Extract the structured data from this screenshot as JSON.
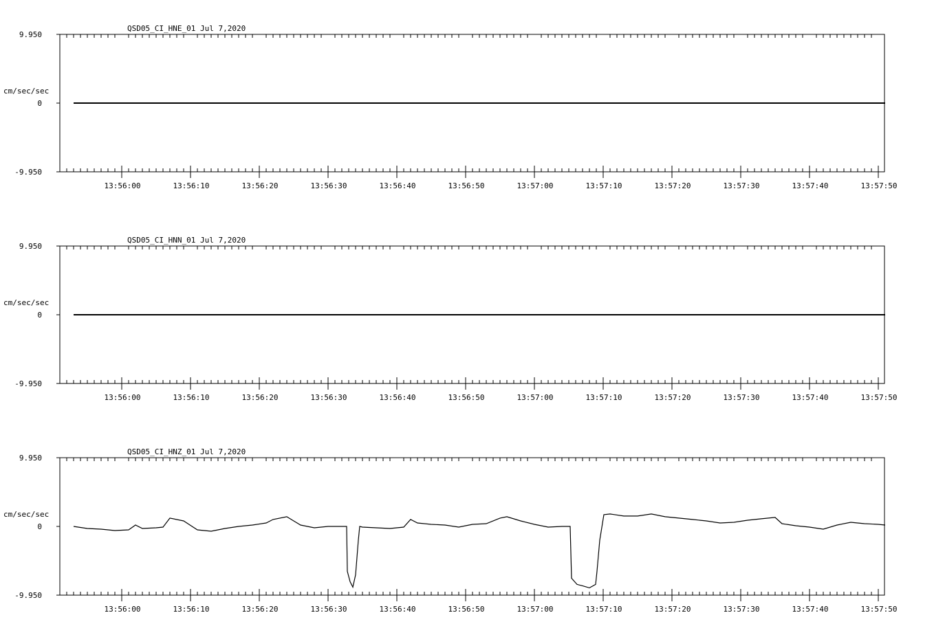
{
  "chart_data": [
    {
      "type": "line",
      "title": "QSD05_CI_HNE_01  Jul 7,2020",
      "ylabel": "cm/sec/sec",
      "ylim": [
        -9.95,
        9.95
      ],
      "y_ticks": [
        "9.950",
        "0",
        "-9.950"
      ],
      "x_ticks": [
        "13:56:00",
        "13:56:10",
        "13:56:20",
        "13:56:30",
        "13:56:40",
        "13:56:50",
        "13:57:00",
        "13:57:10",
        "13:57:20",
        "13:57:30",
        "13:57:40",
        "13:57:50"
      ],
      "series": [
        {
          "x": [
            "13:55:53",
            "13:57:51"
          ],
          "values": [
            0,
            0
          ]
        }
      ]
    },
    {
      "type": "line",
      "title": "QSD05_CI_HNN_01  Jul 7,2020",
      "ylabel": "cm/sec/sec",
      "ylim": [
        -9.95,
        9.95
      ],
      "y_ticks": [
        "9.950",
        "0",
        "-9.950"
      ],
      "x_ticks": [
        "13:56:00",
        "13:56:10",
        "13:56:20",
        "13:56:30",
        "13:56:40",
        "13:56:50",
        "13:57:00",
        "13:57:10",
        "13:57:20",
        "13:57:30",
        "13:57:40",
        "13:57:50"
      ],
      "series": [
        {
          "x": [
            "13:55:53",
            "13:57:51"
          ],
          "values": [
            0,
            0
          ]
        }
      ]
    },
    {
      "type": "line",
      "title": "QSD05_CI_HNZ_01  Jul 7,2020",
      "ylabel": "cm/sec/sec",
      "ylim": [
        -9.95,
        9.95
      ],
      "y_ticks": [
        "9.950",
        "0",
        "-9.950"
      ],
      "x_ticks": [
        "13:56:00",
        "13:56:10",
        "13:56:20",
        "13:56:30",
        "13:56:40",
        "13:56:50",
        "13:57:00",
        "13:57:10",
        "13:57:20",
        "13:57:30",
        "13:57:40",
        "13:57:50"
      ],
      "series": [
        {
          "x": [
            "13:55:53",
            "13:55:55",
            "13:55:57",
            "13:55:59",
            "13:56:01",
            "13:56:02",
            "13:56:03",
            "13:56:05",
            "13:56:06",
            "13:56:07",
            "13:56:09",
            "13:56:11",
            "13:56:13",
            "13:56:15",
            "13:56:17",
            "13:56:19",
            "13:56:21",
            "13:56:22",
            "13:56:24",
            "13:56:25",
            "13:56:26",
            "13:56:28",
            "13:56:30",
            "13:56:32.7",
            "13:56:32.8",
            "13:56:33.2",
            "13:56:33.6",
            "13:56:34.0",
            "13:56:34.4",
            "13:56:34.6",
            "13:56:35",
            "13:56:37",
            "13:56:39",
            "13:56:41",
            "13:56:42",
            "13:56:43",
            "13:56:45",
            "13:56:47",
            "13:56:49",
            "13:56:51",
            "13:56:53",
            "13:56:55",
            "13:56:56",
            "13:56:58",
            "13:57:00",
            "13:57:02",
            "13:57:04",
            "13:57:05.2",
            "13:57:05.4",
            "13:57:06.2",
            "13:57:07",
            "13:57:08",
            "13:57:08.9",
            "13:57:09.1",
            "13:57:09.5",
            "13:57:10.1",
            "13:57:11",
            "13:57:13",
            "13:57:15",
            "13:57:17",
            "13:57:19",
            "13:57:21",
            "13:57:23",
            "13:57:25",
            "13:57:27",
            "13:57:29",
            "13:57:31",
            "13:57:33",
            "13:57:35",
            "13:57:36",
            "13:57:38",
            "13:57:40",
            "13:57:42",
            "13:57:44",
            "13:57:46",
            "13:57:48",
            "13:57:50",
            "13:57:51"
          ],
          "values": [
            0,
            -0.3,
            -0.4,
            -0.6,
            -0.5,
            0.2,
            -0.3,
            -0.2,
            -0.1,
            1.2,
            0.8,
            -0.5,
            -0.7,
            -0.3,
            0,
            0.2,
            0.5,
            1.0,
            1.4,
            0.8,
            0.2,
            -0.2,
            0,
            0,
            -6.5,
            -8.0,
            -8.8,
            -7.0,
            -2.0,
            0,
            -0.1,
            -0.2,
            -0.3,
            -0.1,
            1.0,
            0.5,
            0.3,
            0.2,
            -0.1,
            0.3,
            0.4,
            1.2,
            1.4,
            0.8,
            0.3,
            -0.1,
            0,
            0,
            -7.5,
            -8.4,
            -8.6,
            -8.9,
            -8.4,
            -6.5,
            -2.0,
            1.7,
            1.8,
            1.5,
            1.5,
            1.8,
            1.4,
            1.2,
            1.0,
            0.8,
            0.5,
            0.6,
            0.9,
            1.1,
            1.3,
            0.4,
            0.1,
            -0.1,
            -0.4,
            0.2,
            0.6,
            0.4,
            0.3,
            0.2
          ]
        }
      ]
    }
  ]
}
